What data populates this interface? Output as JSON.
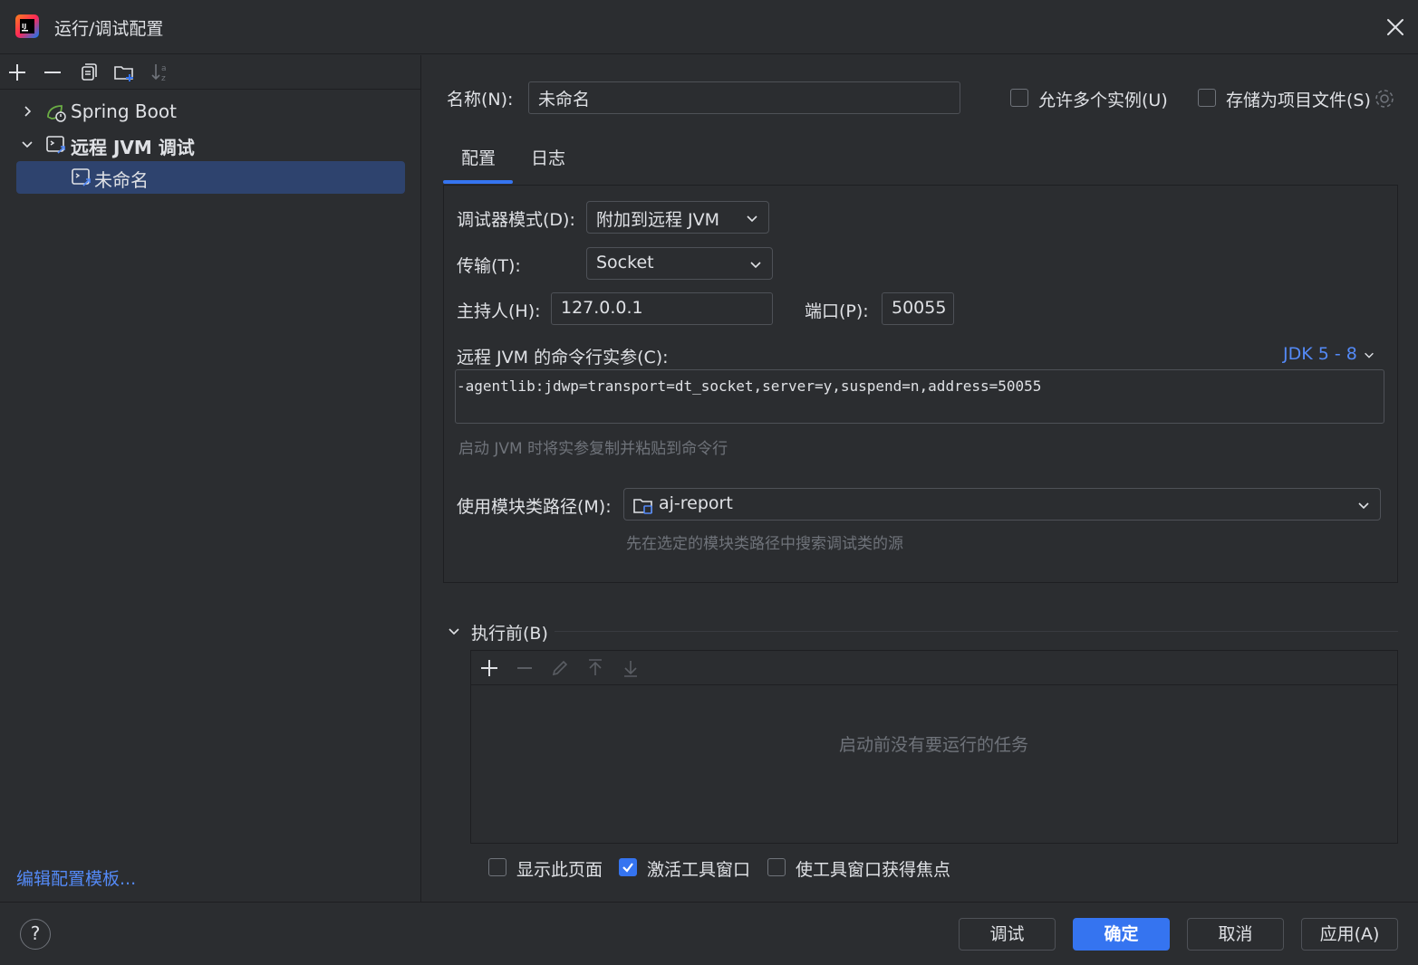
{
  "window": {
    "title": "运行/调试配置"
  },
  "left": {
    "tree": [
      {
        "label": "Spring Boot",
        "expanded": false,
        "icon": "spring-boot-icon"
      },
      {
        "label": "远程 JVM 调试",
        "expanded": true,
        "icon": "remote-jvm-debug-icon"
      },
      {
        "label": "未命名",
        "selected": true,
        "icon": "remote-jvm-debug-icon"
      }
    ],
    "edit_templates": "编辑配置模板..."
  },
  "name": {
    "label": "名称(N):",
    "value": "未命名"
  },
  "options": {
    "allow_multiple": "允许多个实例(U)",
    "store_as_project_file": "存储为项目文件(S)"
  },
  "tabs": [
    {
      "label": "配置",
      "active": true
    },
    {
      "label": "日志"
    }
  ],
  "config": {
    "debugger_mode": {
      "label": "调试器模式(D):",
      "value": "附加到远程 JVM"
    },
    "transport": {
      "label": "传输(T):",
      "value": "Socket"
    },
    "host": {
      "label": "主持人(H):",
      "value": "127.0.0.1"
    },
    "port": {
      "label": "端口(P):",
      "value": "50055"
    },
    "cmd": {
      "label": "远程 JVM 的命令行实参(C):",
      "jdk": "JDK 5 - 8",
      "value": "-agentlib:jdwp=transport=dt_socket,server=y,suspend=n,address=50055",
      "hint": "启动 JVM 时将实参复制并粘贴到命令行"
    },
    "module": {
      "label": "使用模块类路径(M):",
      "value": "aj-report",
      "hint": "先在选定的模块类路径中搜索调试类的源"
    }
  },
  "before_launch": {
    "title": "执行前(B)",
    "empty": "启动前没有要运行的任务"
  },
  "checkboxes": {
    "show_page": {
      "label": "显示此页面",
      "checked": false
    },
    "activate_tool_window": {
      "label": "激活工具窗口",
      "checked": true
    },
    "focus_tool_window": {
      "label": "使工具窗口获得焦点",
      "checked": false
    }
  },
  "buttons": {
    "debug": "调试",
    "ok": "确定",
    "cancel": "取消",
    "apply": "应用(A)"
  },
  "help": "?",
  "colors": {
    "accent": "#3574f0",
    "link": "#548af7",
    "background": "#2b2d30",
    "selection": "#2e436e"
  }
}
